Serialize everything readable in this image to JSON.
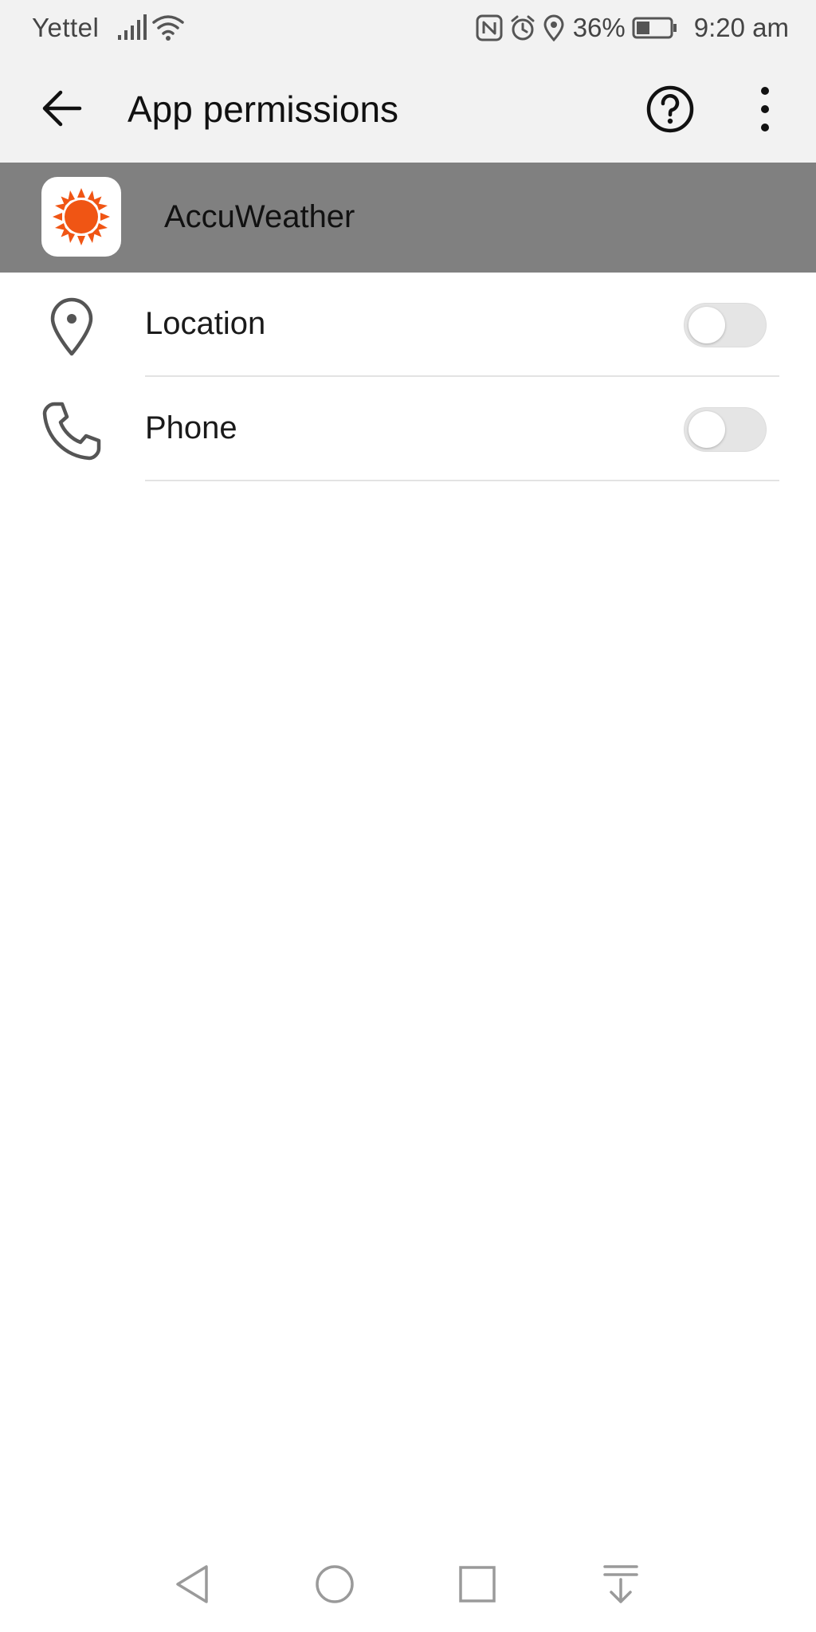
{
  "status_bar": {
    "carrier": "Yettel",
    "battery_percent": "36%",
    "time": "9:20 am",
    "icons": [
      "signal-icon",
      "wifi-icon",
      "nfc-icon",
      "alarm-icon",
      "location-icon",
      "battery-icon"
    ]
  },
  "app_bar": {
    "title": "App permissions",
    "back_icon": "arrow-left-icon",
    "help_icon": "help-circle-icon",
    "more_icon": "more-vertical-icon"
  },
  "app_header": {
    "app_name": "AccuWeather",
    "icon": "accuweather-sun-logo"
  },
  "permissions": [
    {
      "label": "Location",
      "icon": "location-pin-icon",
      "enabled": false
    },
    {
      "label": "Phone",
      "icon": "phone-icon",
      "enabled": false
    }
  ],
  "colors": {
    "accent_orange": "#f05514",
    "header_gray": "#808080",
    "bar_gray": "#f2f2f2"
  },
  "nav_bar": {
    "buttons": [
      "back-triangle-icon",
      "home-circle-icon",
      "recents-square-icon",
      "notification-pulldown-icon"
    ]
  }
}
